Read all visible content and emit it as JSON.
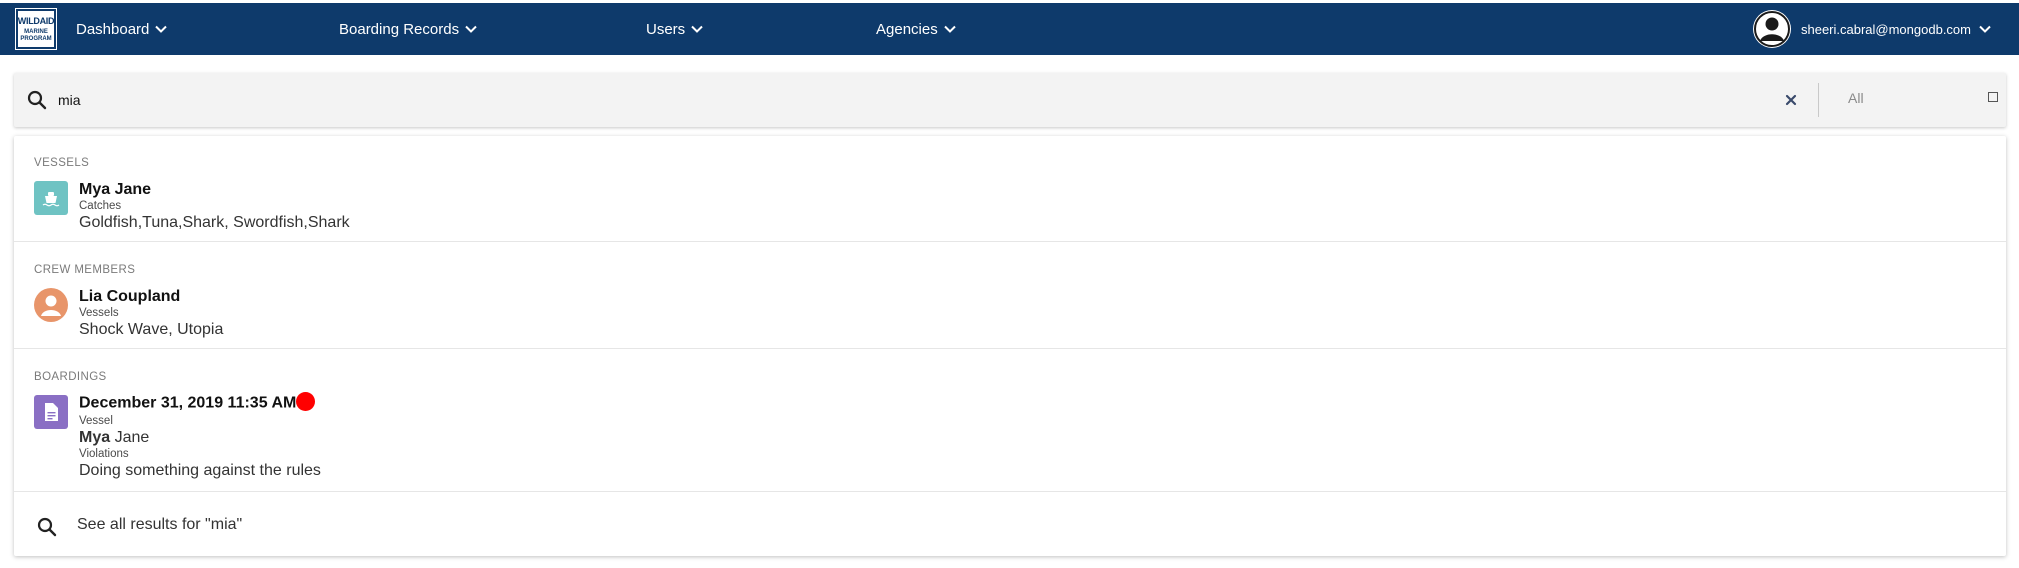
{
  "brand": {
    "logo_line1": "WILDAID",
    "logo_line2": "MARINE",
    "logo_line3": "PROGRAM",
    "color": "#0e3a6b"
  },
  "nav": {
    "items": [
      {
        "label": "Dashboard"
      },
      {
        "label": "Boarding Records"
      },
      {
        "label": "Users"
      },
      {
        "label": "Agencies"
      }
    ],
    "user_email": "sheeri.cabral@mongodb.com"
  },
  "search": {
    "value": "mia",
    "filter_label": "All"
  },
  "results": {
    "vessels": {
      "title": "VESSELS",
      "icon": "boat-icon",
      "icon_color": "#6fc3c3",
      "name": "Mya Jane",
      "sub_label": "Catches",
      "sub_value": "Goldfish,Tuna,Shark, Swordfish,Shark"
    },
    "crew": {
      "title": "CREW MEMBERS",
      "icon": "person-icon",
      "icon_color": "#e8956a",
      "name": "Lia Coupland",
      "sub_label": "Vessels",
      "sub_value": "Shock Wave, Utopia"
    },
    "boardings": {
      "title": "BOARDINGS",
      "icon": "document-icon",
      "icon_color": "#8a6fc4",
      "date": "December 31, 2019 11:35 AM",
      "status_color": "#ff0000",
      "vessel_label": "Vessel",
      "vessel_bold": "Mya",
      "vessel_rest": " Jane",
      "violations_label": "Violations",
      "violations_value": "Doing something against the rules"
    },
    "see_all": "See all results for \"mia\""
  }
}
